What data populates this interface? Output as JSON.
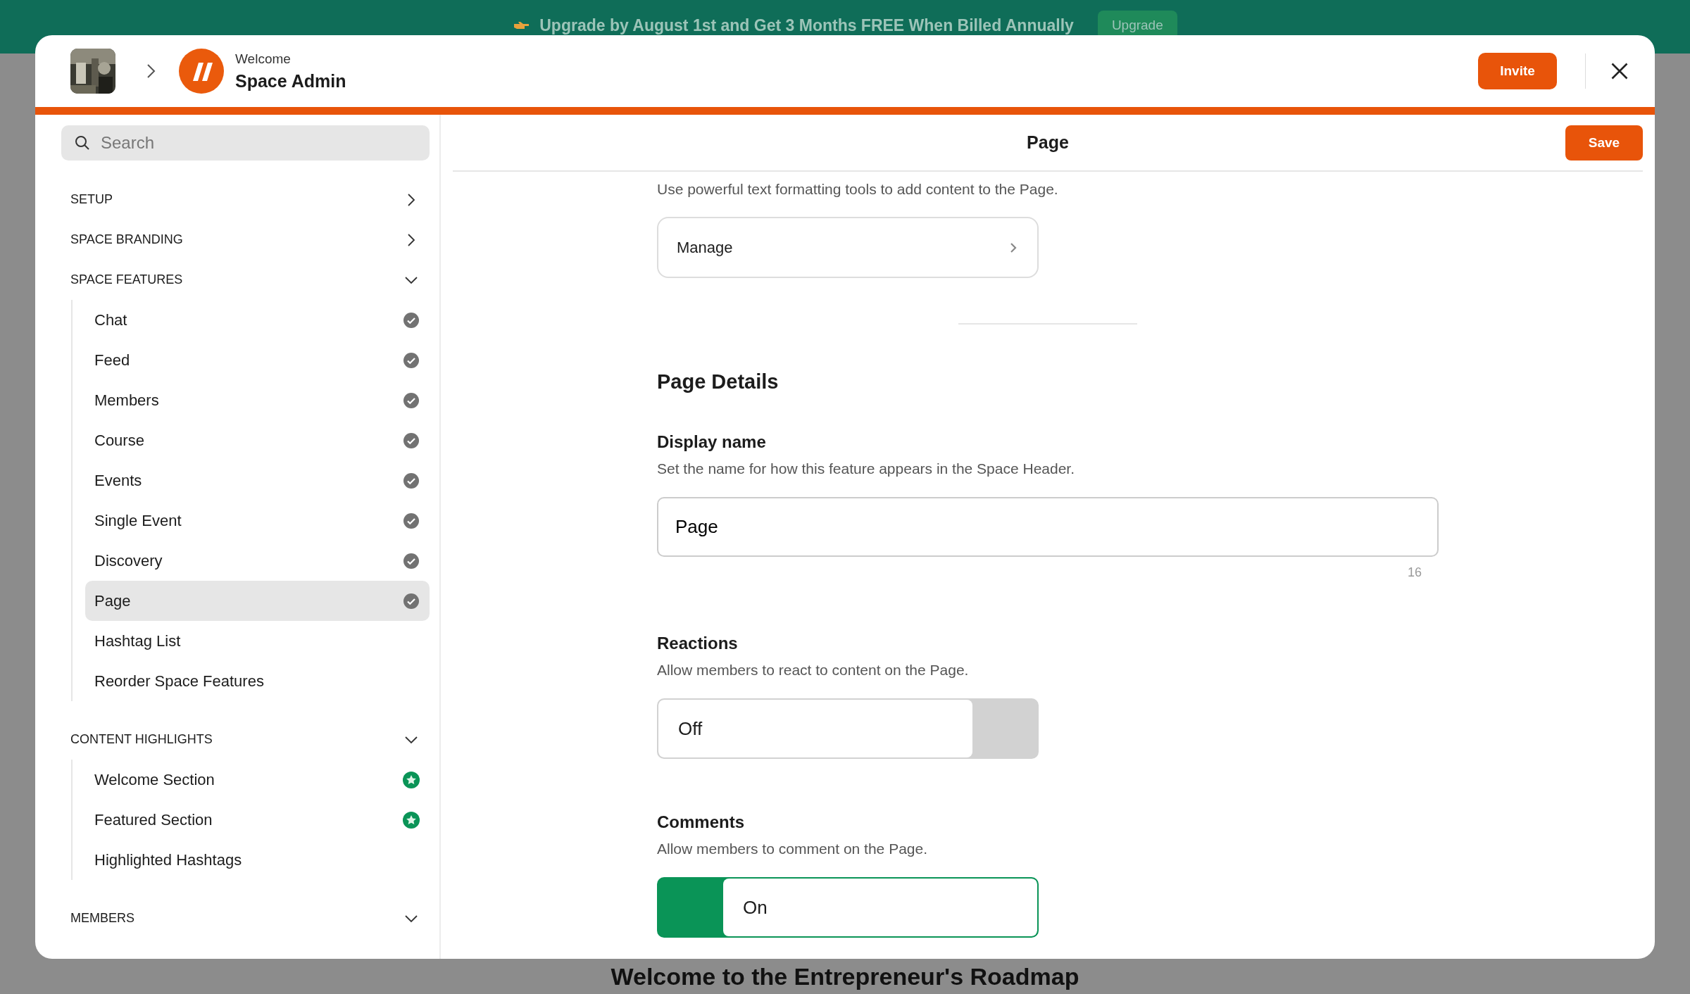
{
  "banner": {
    "message": "Upgrade by August 1st and Get 3 Months FREE When Billed Annually",
    "button": "Upgrade"
  },
  "background_page": {
    "heading": "Welcome to the Entrepreneur's Roadmap"
  },
  "header": {
    "subtitle": "Welcome",
    "title": "Space Admin",
    "invite_button": "Invite"
  },
  "sidebar": {
    "search_placeholder": "Search",
    "sections": [
      {
        "title": "SETUP",
        "expanded": false
      },
      {
        "title": "SPACE BRANDING",
        "expanded": false
      },
      {
        "title": "SPACE FEATURES",
        "expanded": true,
        "items": [
          {
            "label": "Chat",
            "kind": "checked",
            "selected": false
          },
          {
            "label": "Feed",
            "kind": "checked",
            "selected": false
          },
          {
            "label": "Members",
            "kind": "checked",
            "selected": false
          },
          {
            "label": "Course",
            "kind": "checked",
            "selected": false
          },
          {
            "label": "Events",
            "kind": "checked",
            "selected": false
          },
          {
            "label": "Single Event",
            "kind": "checked",
            "selected": false
          },
          {
            "label": "Discovery",
            "kind": "checked",
            "selected": false
          },
          {
            "label": "Page",
            "kind": "checked",
            "selected": true
          },
          {
            "label": "Hashtag List",
            "kind": "plain",
            "selected": false
          },
          {
            "label": "Reorder Space Features",
            "kind": "plain",
            "selected": false
          }
        ]
      },
      {
        "title": "CONTENT HIGHLIGHTS",
        "expanded": true,
        "items": [
          {
            "label": "Welcome Section",
            "kind": "starred",
            "selected": false
          },
          {
            "label": "Featured Section",
            "kind": "starred",
            "selected": false
          },
          {
            "label": "Highlighted Hashtags",
            "kind": "plain",
            "selected": false
          }
        ]
      },
      {
        "title": "MEMBERS",
        "expanded": true
      }
    ]
  },
  "content": {
    "title": "Page",
    "save_button": "Save",
    "intro": "Use powerful text formatting tools to add content to the Page.",
    "manage_button": "Manage",
    "section_title": "Page Details",
    "display_name": {
      "label": "Display name",
      "description": "Set the name for how this feature appears in the Space Header.",
      "value": "Page",
      "counter": "16"
    },
    "toggles": [
      {
        "label": "Reactions",
        "description": "Allow members to react to content on the Page.",
        "state_text": "Off",
        "on": false
      },
      {
        "label": "Comments",
        "description": "Allow members to comment on the Page.",
        "state_text": "On",
        "on": true
      }
    ]
  }
}
